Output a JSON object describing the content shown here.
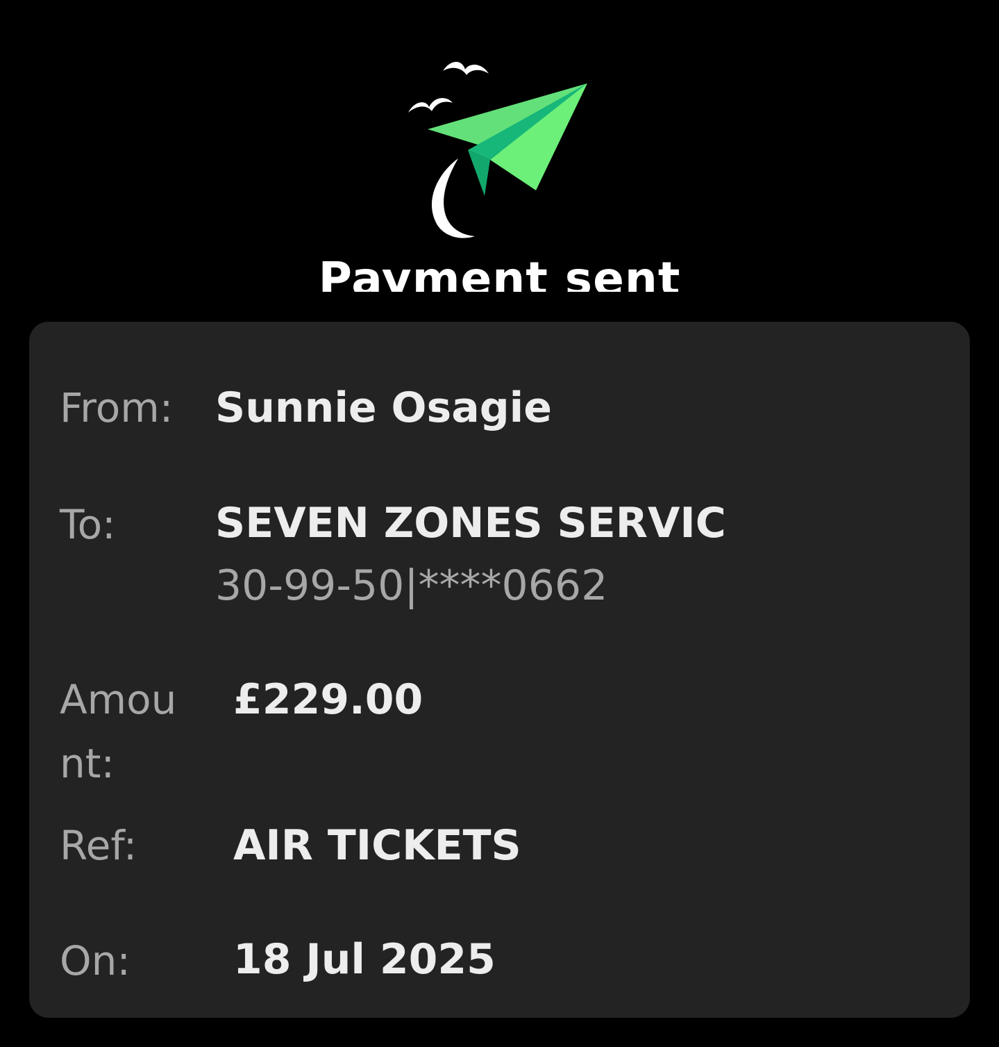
{
  "header": {
    "title": "Payment sent",
    "icon": "paper-plane-with-birds-icon",
    "accent_color": "#5ee07c"
  },
  "details": {
    "from": {
      "label": "From:",
      "value": "Sunnie Osagie"
    },
    "to": {
      "label": "To:",
      "value": "SEVEN ZONES SERVIC",
      "account": "30-99-50|****0662"
    },
    "amount": {
      "label": "Amount:",
      "value": "£229.00"
    },
    "ref": {
      "label": "Ref:",
      "value": "AIR TICKETS"
    },
    "on": {
      "label": "On:",
      "value": "18 Jul 2025"
    }
  }
}
